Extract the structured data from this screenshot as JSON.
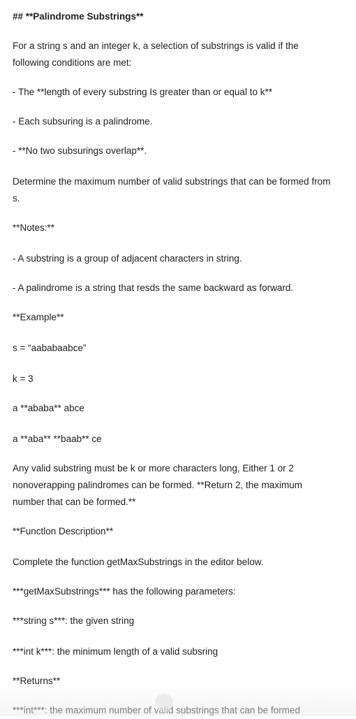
{
  "doc": {
    "title": "## **Palindrome Substrings**",
    "intro_1": "For a string s and an integer k, a selection of substrings is valid if the",
    "intro_2": "following conditions are met:",
    "cond_1": "- The **length of every substring Is greater than or equal to k**",
    "cond_2": "- Each subsuring is a palindrome.",
    "cond_3": "- **No two subsurings overlap**.",
    "determine_1": "Determine the maximum number of valid substrings that can be formed from",
    "determine_2": "s.",
    "notes_heading": "**Notes:**",
    "note_1": "- A substring is a group of adjacent characters in string.",
    "note_2": "- A palindrome is a string that resds the same backward as forward.",
    "example_heading": "**Example**",
    "example_s": "s = “aababаabce”",
    "example_k": "k = 3",
    "example_1": "a **ababa** abce",
    "example_2": "a **aba** **baab** ce",
    "explain_1": "Any valid substring must be k or more characters long, Either 1 or 2",
    "explain_2": "nonoverapping palindromes can be formed. **Return 2, the maximum",
    "explain_3": "number that can be formed.**",
    "function_heading": "**Functlon Description**",
    "function_desc": "Complete the function getMaxSubstrings in the editor below.",
    "params_intro": "***getMaxSubstrings*** has the following parameters:",
    "param_s": "***string s***: the given string",
    "param_k": "***int k***: the minimum length of a valid subsring",
    "returns_heading": "**Returns**",
    "returns_desc": "***int***: the maximum number of valid substrings that can be formed"
  }
}
